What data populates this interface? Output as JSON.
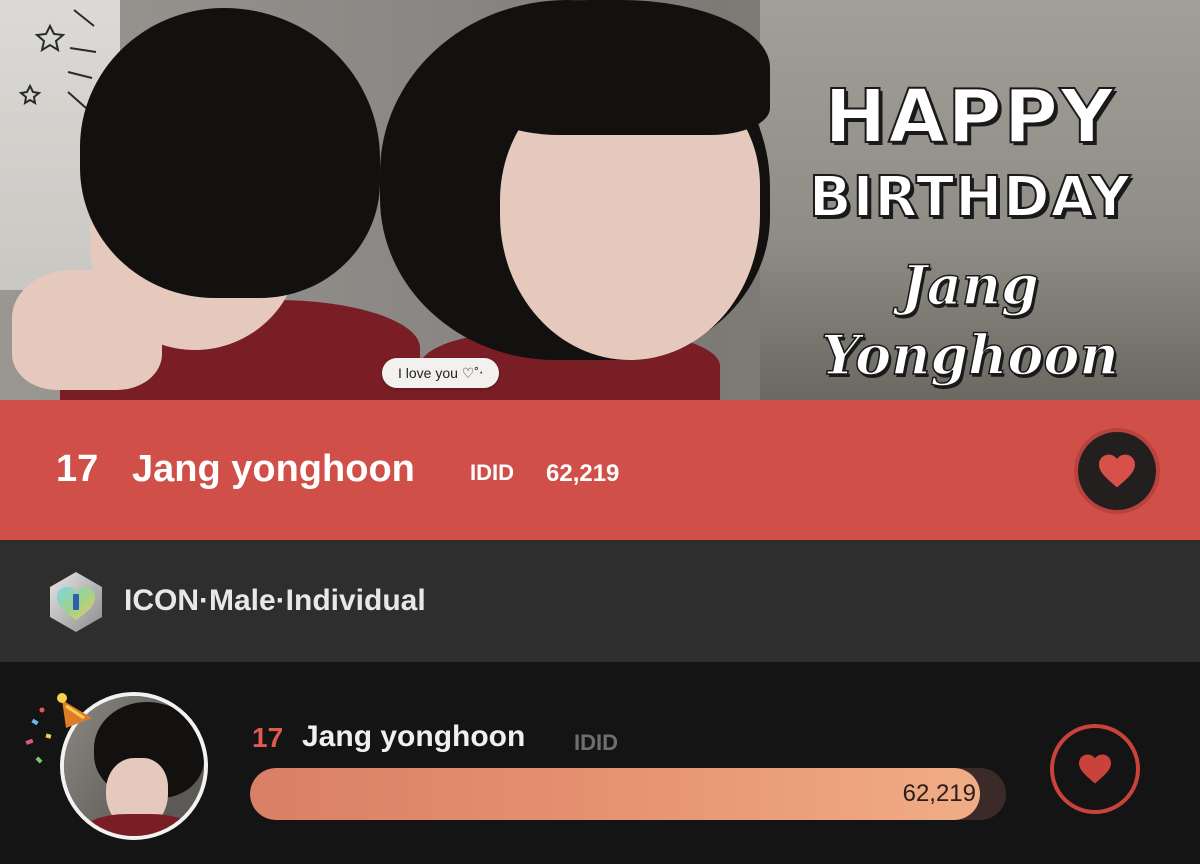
{
  "banner": {
    "title_line1": "HAPPY",
    "title_line2": "BIRTHDAY",
    "name_script": "Jang Yonghoon",
    "chat_bubble": "I love you ♡˚‧"
  },
  "ranking": {
    "rank": "17",
    "name": "Jang yonghoon",
    "group": "IDID",
    "votes": "62,219"
  },
  "category": {
    "badge_icon": "hexagon-heart-badge-icon",
    "badge_letter": "I",
    "label": "ICON·Male·Individual"
  },
  "entry": {
    "rank": "17",
    "name": "Jang yonghoon",
    "group": "IDID",
    "votes": "62,219",
    "progress_fraction": 0.965
  },
  "colors": {
    "accent_red": "#d04f49",
    "heart_red": "#c9433c",
    "progress_orange": "#e79572"
  }
}
